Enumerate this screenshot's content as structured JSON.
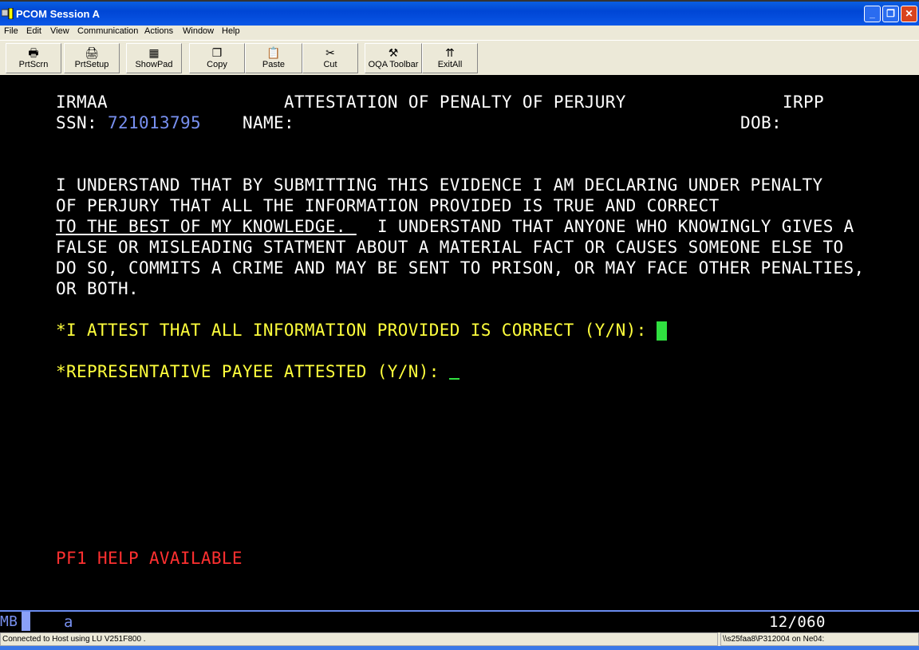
{
  "window": {
    "title": "PCOM Session A"
  },
  "menu": [
    "File",
    "Edit",
    "View",
    "Communication",
    "Actions",
    "Window",
    "Help"
  ],
  "toolbar": [
    {
      "label": "PrtScrn",
      "icon": "print-screen-icon"
    },
    {
      "label": "PrtSetup",
      "icon": "printer-setup-icon"
    },
    {
      "label": "ShowPad",
      "icon": "keypad-icon"
    },
    {
      "label": "Copy",
      "icon": "copy-icon"
    },
    {
      "label": "Paste",
      "icon": "paste-icon"
    },
    {
      "label": "Cut",
      "icon": "scissors-icon"
    },
    {
      "label": "OQA Toolbar",
      "icon": "hammer-icon"
    },
    {
      "label": "ExitAll",
      "icon": "exit-all-icon"
    }
  ],
  "screen": {
    "system": "IRMAA",
    "heading": "ATTESTATION OF PENALTY OF PERJURY",
    "screen_id": "IRPP",
    "ssn_label": "SSN:",
    "ssn": "721013795",
    "name_label": "NAME:",
    "dob_label": "DOB:",
    "text": [
      "I UNDERSTAND THAT BY SUBMITTING THIS EVIDENCE I AM DECLARING UNDER PENALTY",
      "OF PERJURY THAT ALL THE INFORMATION PROVIDED IS TRUE AND CORRECT",
      "TO THE BEST OF MY KNOWLEDGE. ",
      " I UNDERSTAND THAT ANYONE WHO KNOWINGLY GIVES A",
      "FALSE OR MISLEADING STATMENT ABOUT A MATERIAL FACT OR CAUSES SOMEONE ELSE TO",
      "DO SO, COMMITS A CRIME AND MAY BE SENT TO PRISON, OR MAY FACE OTHER PENALTIES,",
      "OR BOTH."
    ],
    "attest_label": "*I ATTEST THAT ALL INFORMATION PROVIDED IS CORRECT (Y/N):",
    "attest_value": "",
    "payee_label": "*REPRESENTATIVE PAYEE ATTESTED (Y/N):",
    "payee_value": "",
    "help": "PF1 HELP AVAILABLE"
  },
  "oia": {
    "mode": "MB",
    "indicator": "a",
    "cursor_pos": "12/060"
  },
  "status": {
    "connection": "Connected to Host using LU V251F800 .",
    "workstation": "\\\\s25faa8\\P312004 on Ne04:"
  }
}
